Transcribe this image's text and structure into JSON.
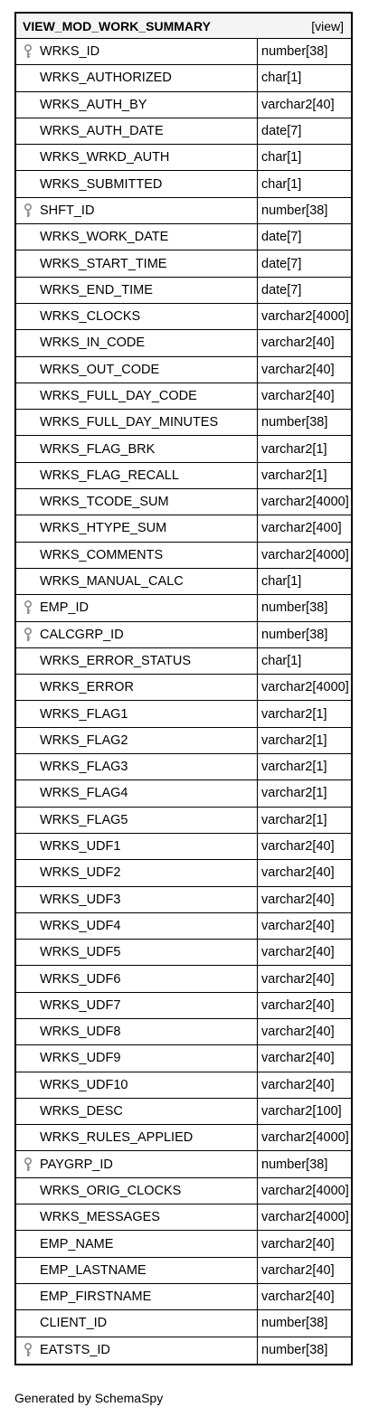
{
  "table": {
    "title": "VIEW_MOD_WORK_SUMMARY",
    "tag": "[view]",
    "columns": [
      {
        "name": "WRKS_ID",
        "type": "number[38]",
        "key": true
      },
      {
        "name": "WRKS_AUTHORIZED",
        "type": "char[1]",
        "key": false
      },
      {
        "name": "WRKS_AUTH_BY",
        "type": "varchar2[40]",
        "key": false
      },
      {
        "name": "WRKS_AUTH_DATE",
        "type": "date[7]",
        "key": false
      },
      {
        "name": "WRKS_WRKD_AUTH",
        "type": "char[1]",
        "key": false
      },
      {
        "name": "WRKS_SUBMITTED",
        "type": "char[1]",
        "key": false
      },
      {
        "name": "SHFT_ID",
        "type": "number[38]",
        "key": true
      },
      {
        "name": "WRKS_WORK_DATE",
        "type": "date[7]",
        "key": false
      },
      {
        "name": "WRKS_START_TIME",
        "type": "date[7]",
        "key": false
      },
      {
        "name": "WRKS_END_TIME",
        "type": "date[7]",
        "key": false
      },
      {
        "name": "WRKS_CLOCKS",
        "type": "varchar2[4000]",
        "key": false
      },
      {
        "name": "WRKS_IN_CODE",
        "type": "varchar2[40]",
        "key": false
      },
      {
        "name": "WRKS_OUT_CODE",
        "type": "varchar2[40]",
        "key": false
      },
      {
        "name": "WRKS_FULL_DAY_CODE",
        "type": "varchar2[40]",
        "key": false
      },
      {
        "name": "WRKS_FULL_DAY_MINUTES",
        "type": "number[38]",
        "key": false
      },
      {
        "name": "WRKS_FLAG_BRK",
        "type": "varchar2[1]",
        "key": false
      },
      {
        "name": "WRKS_FLAG_RECALL",
        "type": "varchar2[1]",
        "key": false
      },
      {
        "name": "WRKS_TCODE_SUM",
        "type": "varchar2[4000]",
        "key": false
      },
      {
        "name": "WRKS_HTYPE_SUM",
        "type": "varchar2[400]",
        "key": false
      },
      {
        "name": "WRKS_COMMENTS",
        "type": "varchar2[4000]",
        "key": false
      },
      {
        "name": "WRKS_MANUAL_CALC",
        "type": "char[1]",
        "key": false
      },
      {
        "name": "EMP_ID",
        "type": "number[38]",
        "key": true
      },
      {
        "name": "CALCGRP_ID",
        "type": "number[38]",
        "key": true
      },
      {
        "name": "WRKS_ERROR_STATUS",
        "type": "char[1]",
        "key": false
      },
      {
        "name": "WRKS_ERROR",
        "type": "varchar2[4000]",
        "key": false
      },
      {
        "name": "WRKS_FLAG1",
        "type": "varchar2[1]",
        "key": false
      },
      {
        "name": "WRKS_FLAG2",
        "type": "varchar2[1]",
        "key": false
      },
      {
        "name": "WRKS_FLAG3",
        "type": "varchar2[1]",
        "key": false
      },
      {
        "name": "WRKS_FLAG4",
        "type": "varchar2[1]",
        "key": false
      },
      {
        "name": "WRKS_FLAG5",
        "type": "varchar2[1]",
        "key": false
      },
      {
        "name": "WRKS_UDF1",
        "type": "varchar2[40]",
        "key": false
      },
      {
        "name": "WRKS_UDF2",
        "type": "varchar2[40]",
        "key": false
      },
      {
        "name": "WRKS_UDF3",
        "type": "varchar2[40]",
        "key": false
      },
      {
        "name": "WRKS_UDF4",
        "type": "varchar2[40]",
        "key": false
      },
      {
        "name": "WRKS_UDF5",
        "type": "varchar2[40]",
        "key": false
      },
      {
        "name": "WRKS_UDF6",
        "type": "varchar2[40]",
        "key": false
      },
      {
        "name": "WRKS_UDF7",
        "type": "varchar2[40]",
        "key": false
      },
      {
        "name": "WRKS_UDF8",
        "type": "varchar2[40]",
        "key": false
      },
      {
        "name": "WRKS_UDF9",
        "type": "varchar2[40]",
        "key": false
      },
      {
        "name": "WRKS_UDF10",
        "type": "varchar2[40]",
        "key": false
      },
      {
        "name": "WRKS_DESC",
        "type": "varchar2[100]",
        "key": false
      },
      {
        "name": "WRKS_RULES_APPLIED",
        "type": "varchar2[4000]",
        "key": false
      },
      {
        "name": "PAYGRP_ID",
        "type": "number[38]",
        "key": true
      },
      {
        "name": "WRKS_ORIG_CLOCKS",
        "type": "varchar2[4000]",
        "key": false
      },
      {
        "name": "WRKS_MESSAGES",
        "type": "varchar2[4000]",
        "key": false
      },
      {
        "name": "EMP_NAME",
        "type": "varchar2[40]",
        "key": false
      },
      {
        "name": "EMP_LASTNAME",
        "type": "varchar2[40]",
        "key": false
      },
      {
        "name": "EMP_FIRSTNAME",
        "type": "varchar2[40]",
        "key": false
      },
      {
        "name": "CLIENT_ID",
        "type": "number[38]",
        "key": false
      },
      {
        "name": "EATSTS_ID",
        "type": "number[38]",
        "key": true
      }
    ]
  },
  "icons": {
    "key": "key-icon"
  },
  "footer": {
    "text": "Generated by SchemaSpy"
  }
}
